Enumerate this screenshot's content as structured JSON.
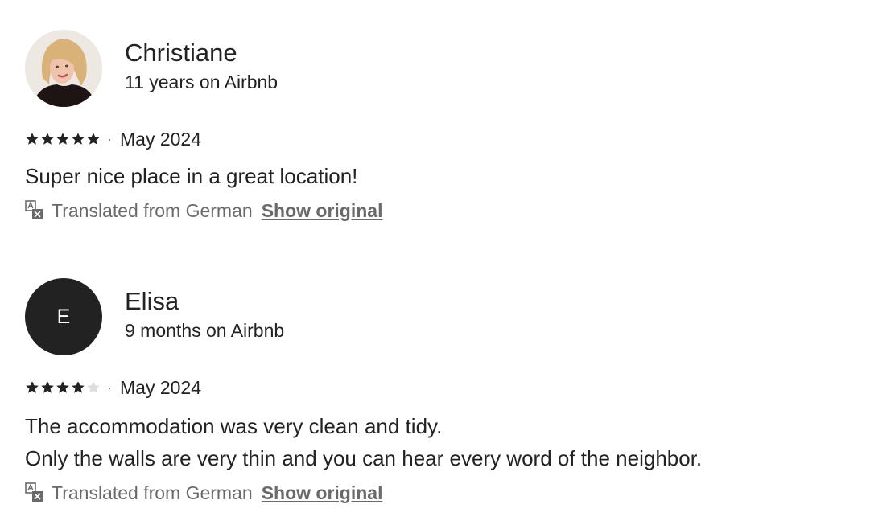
{
  "reviews": [
    {
      "name": "Christiane",
      "tenure": "11 years on Airbnb",
      "avatar": {
        "type": "photo-icon"
      },
      "rating": 5,
      "max_rating": 5,
      "separator": "·",
      "date": "May 2024",
      "text_lines": [
        "Super nice place in a great location!"
      ],
      "translated_label": "Translated from German",
      "show_original_label": "Show original"
    },
    {
      "name": "Elisa",
      "tenure": "9 months on Airbnb",
      "avatar": {
        "type": "initial",
        "initial": "E"
      },
      "rating": 4,
      "max_rating": 5,
      "separator": "·",
      "date": "May 2024",
      "text_lines": [
        "The accommodation was very clean and tidy.",
        "Only the walls are very thin and you can hear every word of the neighbor."
      ],
      "translated_label": "Translated from German",
      "show_original_label": "Show original"
    }
  ],
  "colors": {
    "text": "#222222",
    "muted": "#6a6a6a",
    "star_filled": "#222222",
    "star_empty": "#dddddd",
    "avatar_initial_bg": "#222222"
  },
  "icons": {
    "star": "star-icon",
    "translate": "translate-icon"
  }
}
